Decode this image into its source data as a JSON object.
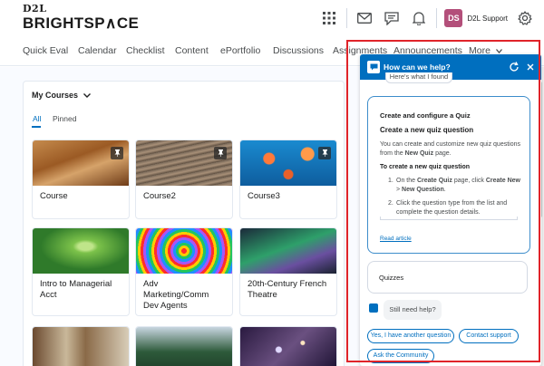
{
  "header": {
    "logo_top": "D2L",
    "logo_main": "BRIGHTSP∧CE",
    "avatar_initials": "DS",
    "user_name": "D2L Support",
    "icons": [
      "grid-icon",
      "mail-icon",
      "chat-icon",
      "bell-icon",
      "gear-icon"
    ]
  },
  "nav": {
    "items": [
      "Quick Eval",
      "Calendar",
      "Checklist",
      "Content",
      "ePortfolio",
      "Discussions",
      "Assignments",
      "Announcements",
      "More"
    ]
  },
  "courses_widget": {
    "title": "My Courses",
    "tabs": [
      "All",
      "Pinned"
    ],
    "cards": [
      {
        "title": "Course"
      },
      {
        "title": "Course2"
      },
      {
        "title": "Course3"
      },
      {
        "title": "Intro to Managerial Acct"
      },
      {
        "title": "Adv Marketing/Comm Dev Agents"
      },
      {
        "title": "20th-Century French Theatre"
      },
      {
        "title": ""
      },
      {
        "title": ""
      },
      {
        "title": ""
      }
    ]
  },
  "chat": {
    "title": "How can we help?",
    "previous_bubble": "Here's what I found",
    "article": {
      "category": "Create and configure a Quiz",
      "heading": "Create a new quiz question",
      "intro_pre": "You can create and customize new quiz questions from the ",
      "intro_bold": "New Quiz",
      "intro_post": " page.",
      "subheading": "To create a new quiz question",
      "step1_pre": "On the ",
      "step1_bold1": "Create Quiz",
      "step1_mid": " page, click ",
      "step1_bold2": "Create New",
      "step1_sep": " > ",
      "step1_bold3": "New Question",
      "step1_post": ".",
      "step2": "Click the question type from the list and complete the question details.",
      "link": "Read article"
    },
    "quizzes_bubble": "Quizzes",
    "still_need_help": "Still need help?",
    "quick_replies": [
      "Yes, I have another question",
      "Contact support",
      "Ask the Community"
    ]
  },
  "colors": {
    "accent": "#006fbf",
    "highlight_border": "#e0242a",
    "avatar": "#b34f7a"
  }
}
